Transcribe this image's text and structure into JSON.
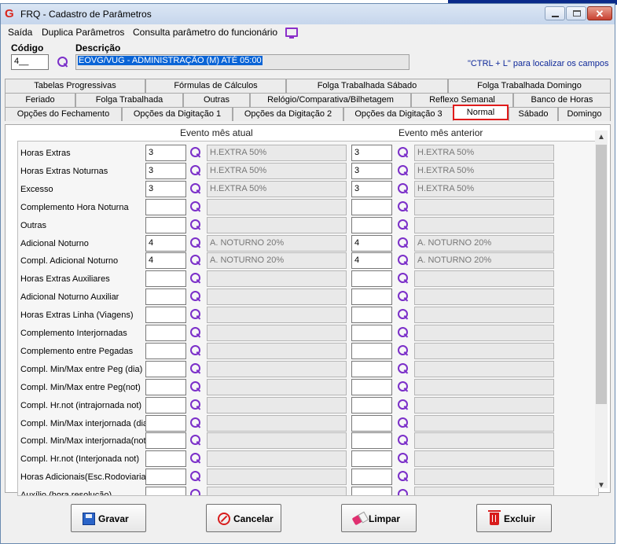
{
  "window": {
    "title": "FRQ - Cadastro de Parâmetros",
    "app_icon_glyph": "G",
    "close_glyph": "✕"
  },
  "menu": {
    "items": [
      "Saída",
      "Duplica Parâmetros",
      "Consulta parâmetro do funcionário"
    ],
    "monitor_icon": "monitor-icon"
  },
  "form": {
    "codigo_label": "Código",
    "codigo_value": "4__",
    "descricao_label": "Descrição",
    "descricao_value": "EOVG/VUG - ADMINISTRAÇÃO (M) ATÉ 05:00",
    "hint": "\"CTRL + L\" para localizar os campos"
  },
  "tabs": {
    "row1": [
      "Tabelas Progressivas",
      "Fórmulas de Cálculos",
      "Folga Trabalhada Sábado",
      "Folga Trabalhada Domingo"
    ],
    "row2": [
      "Feriado",
      "Folga Trabalhada",
      "Outras",
      "Relógio/Comparativa/Bilhetagem",
      "Reflexo Semanal",
      "Banco de Horas"
    ],
    "row3": [
      "Opções do Fechamento",
      "Opções da Digitação 1",
      "Opções da Digitação 2",
      "Opções da Digitação 3",
      "Normal",
      "Sábado",
      "Domingo"
    ],
    "active": "Normal"
  },
  "columns": {
    "current": "Evento mês atual",
    "previous": "Evento mês anterior"
  },
  "rows": [
    {
      "label": "Horas Extras",
      "cur_code": "3",
      "cur_desc": "H.EXTRA 50%",
      "prev_code": "3",
      "prev_desc": "H.EXTRA 50%"
    },
    {
      "label": "Horas Extras Noturnas",
      "cur_code": "3",
      "cur_desc": "H.EXTRA 50%",
      "prev_code": "3",
      "prev_desc": "H.EXTRA 50%"
    },
    {
      "label": "Excesso",
      "cur_code": "3",
      "cur_desc": "H.EXTRA 50%",
      "prev_code": "3",
      "prev_desc": "H.EXTRA 50%"
    },
    {
      "label": "Complemento Hora Noturna",
      "cur_code": "",
      "cur_desc": "",
      "prev_code": "",
      "prev_desc": ""
    },
    {
      "label": "Outras",
      "cur_code": "",
      "cur_desc": "",
      "prev_code": "",
      "prev_desc": ""
    },
    {
      "label": "Adicional Noturno",
      "cur_code": "4",
      "cur_desc": "A. NOTURNO 20%",
      "prev_code": "4",
      "prev_desc": "A. NOTURNO 20%"
    },
    {
      "label": "Compl. Adicional Noturno",
      "cur_code": "4",
      "cur_desc": "A. NOTURNO 20%",
      "prev_code": "4",
      "prev_desc": "A. NOTURNO 20%"
    },
    {
      "label": "Horas Extras Auxiliares",
      "cur_code": "",
      "cur_desc": "",
      "prev_code": "",
      "prev_desc": ""
    },
    {
      "label": "Adicional Noturno Auxiliar",
      "cur_code": "",
      "cur_desc": "",
      "prev_code": "",
      "prev_desc": ""
    },
    {
      "label": "Horas Extras Linha (Viagens)",
      "cur_code": "",
      "cur_desc": "",
      "prev_code": "",
      "prev_desc": ""
    },
    {
      "label": "Complemento Interjornadas",
      "cur_code": "",
      "cur_desc": "",
      "prev_code": "",
      "prev_desc": ""
    },
    {
      "label": "Complemento entre Pegadas",
      "cur_code": "",
      "cur_desc": "",
      "prev_code": "",
      "prev_desc": ""
    },
    {
      "label": "Compl. Min/Max entre Peg (dia)",
      "cur_code": "",
      "cur_desc": "",
      "prev_code": "",
      "prev_desc": ""
    },
    {
      "label": "Compl. Min/Max entre Peg(not)",
      "cur_code": "",
      "cur_desc": "",
      "prev_code": "",
      "prev_desc": ""
    },
    {
      "label": "Compl. Hr.not (intrajornada not)",
      "cur_code": "",
      "cur_desc": "",
      "prev_code": "",
      "prev_desc": ""
    },
    {
      "label": "Compl. Min/Max interjornada (dia)",
      "cur_code": "",
      "cur_desc": "",
      "prev_code": "",
      "prev_desc": ""
    },
    {
      "label": "Compl. Min/Max interjornada(not)",
      "cur_code": "",
      "cur_desc": "",
      "prev_code": "",
      "prev_desc": ""
    },
    {
      "label": "Compl. Hr.not (Interjonada not)",
      "cur_code": "",
      "cur_desc": "",
      "prev_code": "",
      "prev_desc": ""
    },
    {
      "label": "Horas Adicionais(Esc.Rodoviaria)",
      "cur_code": "",
      "cur_desc": "",
      "prev_code": "",
      "prev_desc": ""
    },
    {
      "label": "Auxílio (hora resolução)",
      "cur_code": "",
      "cur_desc": "",
      "prev_code": "",
      "prev_desc": ""
    }
  ],
  "scrollbar": {
    "up_glyph": "▲",
    "down_glyph": "▼"
  },
  "buttons": {
    "save": "Gravar",
    "cancel": "Cancelar",
    "clear": "Limpar",
    "delete": "Excluir"
  }
}
